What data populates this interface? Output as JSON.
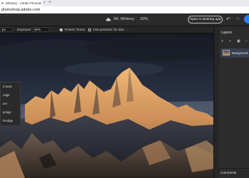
{
  "browser": {
    "tab_title": "N. Whitney - Adobe Photosh",
    "tab_close": "×",
    "new_tab": "+",
    "url": "photoshop.adobe.com"
  },
  "header": {
    "doc_name": "Mt. Whitney",
    "zoom": "33%",
    "open_desktop_label": "Open in desktop app",
    "undo": "↶",
    "redo": "↷"
  },
  "options": {
    "size_value": "px",
    "exposure_label": "Exposure",
    "exposure_value": "50%",
    "protect_tones_label": "Protect Tones",
    "pressure_label": "Use pressure for size",
    "more": "···"
  },
  "tool_flyout": {
    "items": [
      "d tools",
      "odge",
      "urn",
      "ponge",
      "lmudge"
    ]
  },
  "panel": {
    "title": "Layers",
    "layer_name": "Background",
    "comments_label": "Comments"
  },
  "colors": {
    "accent": "#2d7df6",
    "app_bg": "#1d1d1d",
    "panel_bg": "#2c2c2c",
    "selected_layer": "#3a3f4f"
  }
}
